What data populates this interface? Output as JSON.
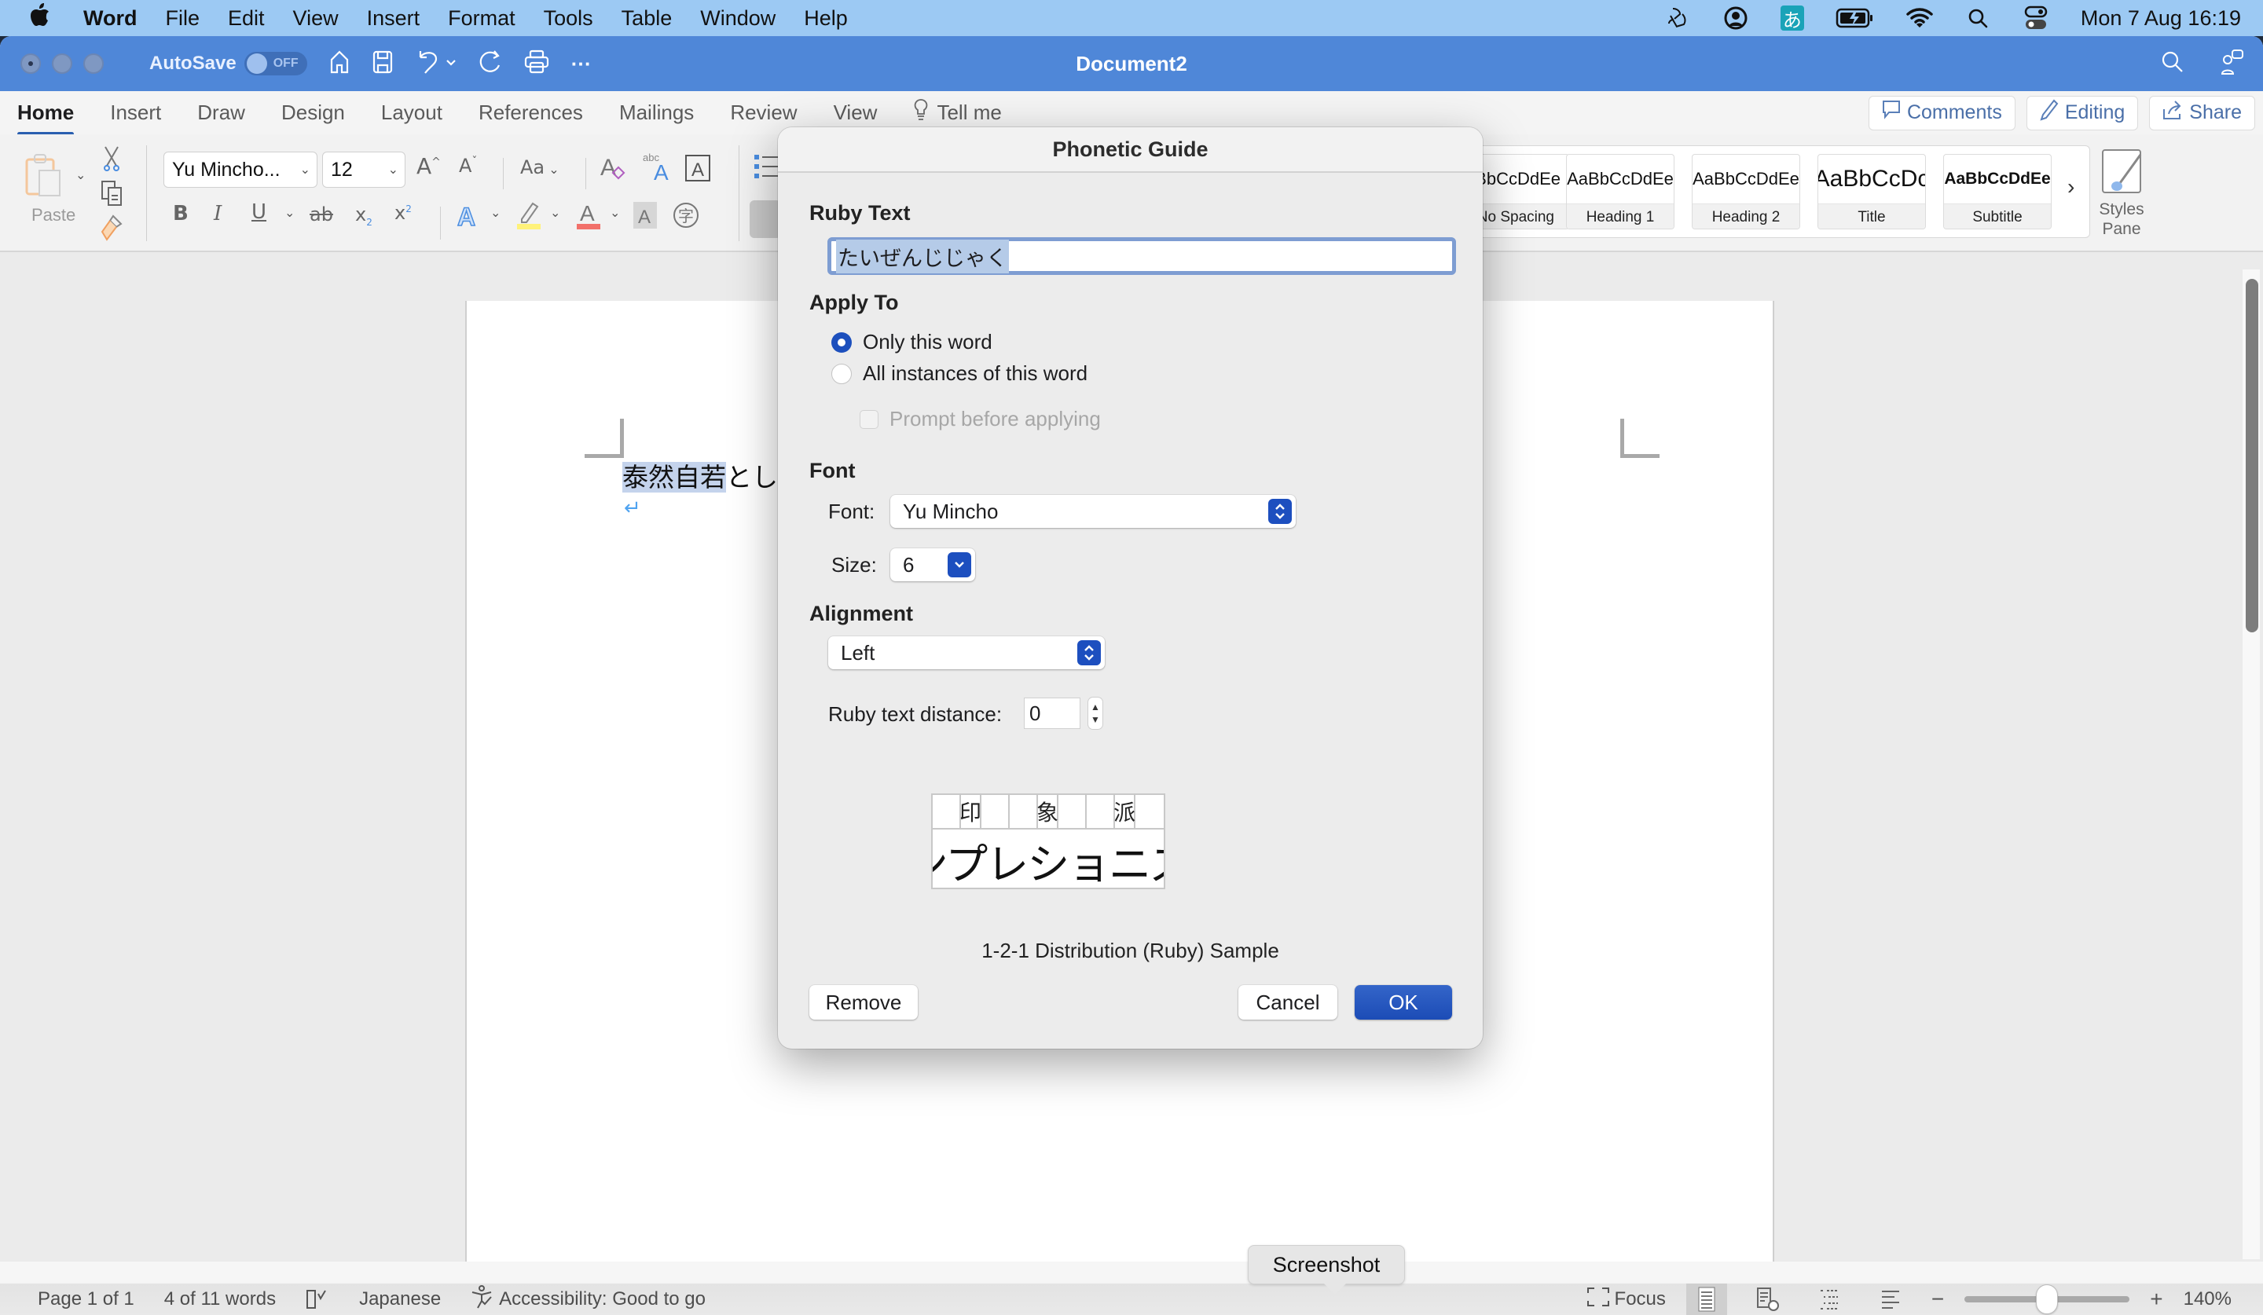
{
  "menubar": {
    "app_name": "Word",
    "items": [
      "File",
      "Edit",
      "View",
      "Insert",
      "Format",
      "Tools",
      "Table",
      "Window",
      "Help"
    ],
    "status_icons": [
      "stage-manager-icon",
      "user-account-icon",
      "input-method-icon",
      "battery-charging-icon",
      "wifi-icon",
      "spotlight-search-icon",
      "control-center-icon"
    ],
    "ime_glyph": "あ",
    "clock": "Mon 7 Aug  16:19"
  },
  "titlebar": {
    "autosave_label": "AutoSave",
    "autosave_state": "OFF",
    "document_title": "Document2",
    "more_glyph": "···"
  },
  "tabs": {
    "items": [
      "Home",
      "Insert",
      "Draw",
      "Design",
      "Layout",
      "References",
      "Mailings",
      "Review",
      "View"
    ],
    "active": "Home",
    "tell_me": "Tell me",
    "comments": "Comments",
    "editing": "Editing",
    "share": "Share"
  },
  "ribbon": {
    "paste_label": "Paste",
    "font_name": "Yu Mincho...",
    "font_size": "12",
    "change_case": "Aa",
    "styles": [
      {
        "sample": "AaBbCcDdEe",
        "name": "No Spacing"
      },
      {
        "sample": "AaBbCcDdEe",
        "name": "Heading 1"
      },
      {
        "sample": "AaBbCcDdEe",
        "name": "Heading 2"
      },
      {
        "sample": "AaBbCcDc",
        "name": "Title"
      },
      {
        "sample": "AaBbCcDdEe",
        "name": "Subtitle"
      }
    ],
    "styles_pane_label_1": "Styles",
    "styles_pane_label_2": "Pane"
  },
  "document": {
    "selected_text": "泰然自若",
    "following_text": "とし",
    "paragraph_mark": "↵"
  },
  "dialog": {
    "title": "Phonetic Guide",
    "ruby_section": "Ruby Text",
    "ruby_text": "たいぜんじじゃく",
    "apply_section": "Apply To",
    "apply_options": [
      {
        "label": "Only this word",
        "selected": true
      },
      {
        "label": "All instances of this word",
        "selected": false
      }
    ],
    "prompt_label": "Prompt before applying",
    "prompt_checked": false,
    "font_section": "Font",
    "font_label": "Font:",
    "font_value": "Yu Mincho",
    "size_label": "Size:",
    "size_value": "6",
    "alignment_section": "Alignment",
    "alignment_value": "Left",
    "distance_label": "Ruby text distance:",
    "distance_value": "0",
    "sample": {
      "ruby_chars": [
        "",
        "印",
        "",
        "",
        "象",
        "",
        "",
        "派",
        ""
      ],
      "base_text": "インプレショニズム"
    },
    "sample_caption": "1-2-1 Distribution (Ruby) Sample",
    "remove_label": "Remove",
    "cancel_label": "Cancel",
    "ok_label": "OK"
  },
  "statusbar": {
    "page": "Page 1 of 1",
    "words": "4 of 11 words",
    "language": "Japanese",
    "accessibility": "Accessibility: Good to go",
    "focus": "Focus",
    "zoom_percent": "140%",
    "zoom_value": 140,
    "zoom_slider_fraction": 0.5,
    "tooltip": "Screenshot"
  },
  "colors": {
    "titlebar": "#4f87d8",
    "menubar": "#9cc9f3",
    "accent": "#1c4fbd",
    "selection": "#c4d3ec"
  }
}
